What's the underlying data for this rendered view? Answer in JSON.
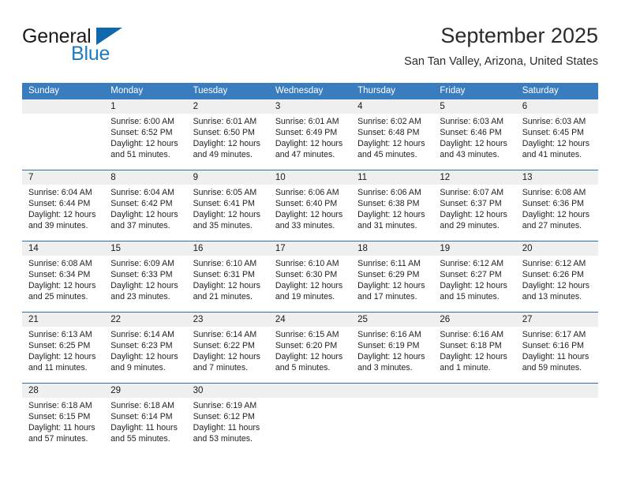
{
  "logo": {
    "word_one": "General",
    "word_two": "Blue",
    "brand_color": "#1f7bc1"
  },
  "header": {
    "title": "September 2025",
    "subtitle": "San Tan Valley, Arizona, United States"
  },
  "calendar": {
    "header_color": "#3a7dbf",
    "daynum_band_color": "#efefef",
    "weekdays": [
      "Sunday",
      "Monday",
      "Tuesday",
      "Wednesday",
      "Thursday",
      "Friday",
      "Saturday"
    ],
    "weeks": [
      [
        {
          "day": "",
          "lines": [
            "",
            "",
            "",
            ""
          ]
        },
        {
          "day": "1",
          "lines": [
            "Sunrise: 6:00 AM",
            "Sunset: 6:52 PM",
            "Daylight: 12 hours",
            "and 51 minutes."
          ]
        },
        {
          "day": "2",
          "lines": [
            "Sunrise: 6:01 AM",
            "Sunset: 6:50 PM",
            "Daylight: 12 hours",
            "and 49 minutes."
          ]
        },
        {
          "day": "3",
          "lines": [
            "Sunrise: 6:01 AM",
            "Sunset: 6:49 PM",
            "Daylight: 12 hours",
            "and 47 minutes."
          ]
        },
        {
          "day": "4",
          "lines": [
            "Sunrise: 6:02 AM",
            "Sunset: 6:48 PM",
            "Daylight: 12 hours",
            "and 45 minutes."
          ]
        },
        {
          "day": "5",
          "lines": [
            "Sunrise: 6:03 AM",
            "Sunset: 6:46 PM",
            "Daylight: 12 hours",
            "and 43 minutes."
          ]
        },
        {
          "day": "6",
          "lines": [
            "Sunrise: 6:03 AM",
            "Sunset: 6:45 PM",
            "Daylight: 12 hours",
            "and 41 minutes."
          ]
        }
      ],
      [
        {
          "day": "7",
          "lines": [
            "Sunrise: 6:04 AM",
            "Sunset: 6:44 PM",
            "Daylight: 12 hours",
            "and 39 minutes."
          ]
        },
        {
          "day": "8",
          "lines": [
            "Sunrise: 6:04 AM",
            "Sunset: 6:42 PM",
            "Daylight: 12 hours",
            "and 37 minutes."
          ]
        },
        {
          "day": "9",
          "lines": [
            "Sunrise: 6:05 AM",
            "Sunset: 6:41 PM",
            "Daylight: 12 hours",
            "and 35 minutes."
          ]
        },
        {
          "day": "10",
          "lines": [
            "Sunrise: 6:06 AM",
            "Sunset: 6:40 PM",
            "Daylight: 12 hours",
            "and 33 minutes."
          ]
        },
        {
          "day": "11",
          "lines": [
            "Sunrise: 6:06 AM",
            "Sunset: 6:38 PM",
            "Daylight: 12 hours",
            "and 31 minutes."
          ]
        },
        {
          "day": "12",
          "lines": [
            "Sunrise: 6:07 AM",
            "Sunset: 6:37 PM",
            "Daylight: 12 hours",
            "and 29 minutes."
          ]
        },
        {
          "day": "13",
          "lines": [
            "Sunrise: 6:08 AM",
            "Sunset: 6:36 PM",
            "Daylight: 12 hours",
            "and 27 minutes."
          ]
        }
      ],
      [
        {
          "day": "14",
          "lines": [
            "Sunrise: 6:08 AM",
            "Sunset: 6:34 PM",
            "Daylight: 12 hours",
            "and 25 minutes."
          ]
        },
        {
          "day": "15",
          "lines": [
            "Sunrise: 6:09 AM",
            "Sunset: 6:33 PM",
            "Daylight: 12 hours",
            "and 23 minutes."
          ]
        },
        {
          "day": "16",
          "lines": [
            "Sunrise: 6:10 AM",
            "Sunset: 6:31 PM",
            "Daylight: 12 hours",
            "and 21 minutes."
          ]
        },
        {
          "day": "17",
          "lines": [
            "Sunrise: 6:10 AM",
            "Sunset: 6:30 PM",
            "Daylight: 12 hours",
            "and 19 minutes."
          ]
        },
        {
          "day": "18",
          "lines": [
            "Sunrise: 6:11 AM",
            "Sunset: 6:29 PM",
            "Daylight: 12 hours",
            "and 17 minutes."
          ]
        },
        {
          "day": "19",
          "lines": [
            "Sunrise: 6:12 AM",
            "Sunset: 6:27 PM",
            "Daylight: 12 hours",
            "and 15 minutes."
          ]
        },
        {
          "day": "20",
          "lines": [
            "Sunrise: 6:12 AM",
            "Sunset: 6:26 PM",
            "Daylight: 12 hours",
            "and 13 minutes."
          ]
        }
      ],
      [
        {
          "day": "21",
          "lines": [
            "Sunrise: 6:13 AM",
            "Sunset: 6:25 PM",
            "Daylight: 12 hours",
            "and 11 minutes."
          ]
        },
        {
          "day": "22",
          "lines": [
            "Sunrise: 6:14 AM",
            "Sunset: 6:23 PM",
            "Daylight: 12 hours",
            "and 9 minutes."
          ]
        },
        {
          "day": "23",
          "lines": [
            "Sunrise: 6:14 AM",
            "Sunset: 6:22 PM",
            "Daylight: 12 hours",
            "and 7 minutes."
          ]
        },
        {
          "day": "24",
          "lines": [
            "Sunrise: 6:15 AM",
            "Sunset: 6:20 PM",
            "Daylight: 12 hours",
            "and 5 minutes."
          ]
        },
        {
          "day": "25",
          "lines": [
            "Sunrise: 6:16 AM",
            "Sunset: 6:19 PM",
            "Daylight: 12 hours",
            "and 3 minutes."
          ]
        },
        {
          "day": "26",
          "lines": [
            "Sunrise: 6:16 AM",
            "Sunset: 6:18 PM",
            "Daylight: 12 hours",
            "and 1 minute."
          ]
        },
        {
          "day": "27",
          "lines": [
            "Sunrise: 6:17 AM",
            "Sunset: 6:16 PM",
            "Daylight: 11 hours",
            "and 59 minutes."
          ]
        }
      ],
      [
        {
          "day": "28",
          "lines": [
            "Sunrise: 6:18 AM",
            "Sunset: 6:15 PM",
            "Daylight: 11 hours",
            "and 57 minutes."
          ]
        },
        {
          "day": "29",
          "lines": [
            "Sunrise: 6:18 AM",
            "Sunset: 6:14 PM",
            "Daylight: 11 hours",
            "and 55 minutes."
          ]
        },
        {
          "day": "30",
          "lines": [
            "Sunrise: 6:19 AM",
            "Sunset: 6:12 PM",
            "Daylight: 11 hours",
            "and 53 minutes."
          ]
        },
        {
          "day": "",
          "lines": [
            "",
            "",
            "",
            ""
          ]
        },
        {
          "day": "",
          "lines": [
            "",
            "",
            "",
            ""
          ]
        },
        {
          "day": "",
          "lines": [
            "",
            "",
            "",
            ""
          ]
        },
        {
          "day": "",
          "lines": [
            "",
            "",
            "",
            ""
          ]
        }
      ]
    ]
  }
}
